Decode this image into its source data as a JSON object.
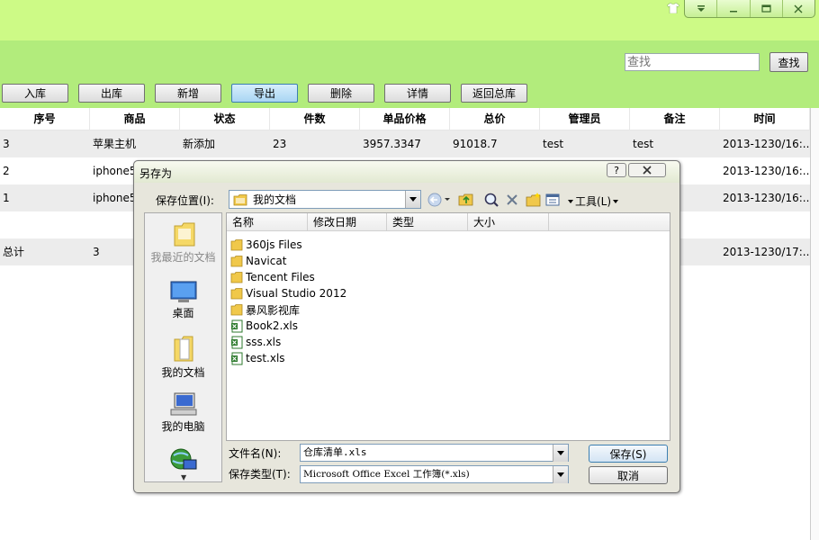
{
  "header": {
    "search_placeholder": "查找",
    "search_button": "查找"
  },
  "toolbar": {
    "buttons": [
      "入库",
      "出库",
      "新增",
      "导出",
      "删除",
      "详情",
      "返回总库"
    ]
  },
  "table": {
    "columns": [
      "序号",
      "商品",
      "状态",
      "件数",
      "单品价格",
      "总价",
      "管理员",
      "备注",
      "时间"
    ],
    "rows": [
      [
        "3",
        "苹果主机",
        "新添加",
        "23",
        "3957.3347",
        "91018.7",
        "test",
        "test",
        "2013-1230/16:..."
      ],
      [
        "2",
        "iphone5",
        "",
        "",
        "",
        "",
        "",
        "",
        "2013-1230/16:..."
      ],
      [
        "1",
        "iphone5",
        "",
        "",
        "",
        "",
        "",
        "",
        "2013-1230/16:..."
      ]
    ],
    "total_row": [
      "总计",
      "3",
      "2013-1230/17:..."
    ]
  },
  "dialog": {
    "title": "另存为",
    "help": "?",
    "save_in_label": "保存位置(I):",
    "location": "我的文档",
    "tools_label": "工具(L)",
    "places": [
      "我最近的文档",
      "桌面",
      "我的文档",
      "我的电脑"
    ],
    "columns": [
      "名称",
      "修改日期",
      "类型",
      "大小"
    ],
    "files": [
      {
        "name": "360js Files",
        "type": "folder"
      },
      {
        "name": "Navicat",
        "type": "folder"
      },
      {
        "name": "Tencent Files",
        "type": "folder"
      },
      {
        "name": "Visual Studio 2012",
        "type": "folder"
      },
      {
        "name": "暴风影视库",
        "type": "folder"
      },
      {
        "name": "Book2.xls",
        "type": "xls"
      },
      {
        "name": "sss.xls",
        "type": "xls"
      },
      {
        "name": "test.xls",
        "type": "xls"
      }
    ],
    "filename_label": "文件名(N):",
    "filename_value": "仓库清单.xls",
    "filetype_label": "保存类型(T):",
    "filetype_value": "Microsoft Office Excel 工作簿(*.xls)",
    "save_button": "保存(S)",
    "cancel_button": "取消"
  },
  "colors": {
    "header_top": "#cdfa86",
    "header_band": "#b2ec7c",
    "row_alt": "#ececec",
    "dialog_bg": "#e7e6dc",
    "folder": "#f0c84a"
  }
}
